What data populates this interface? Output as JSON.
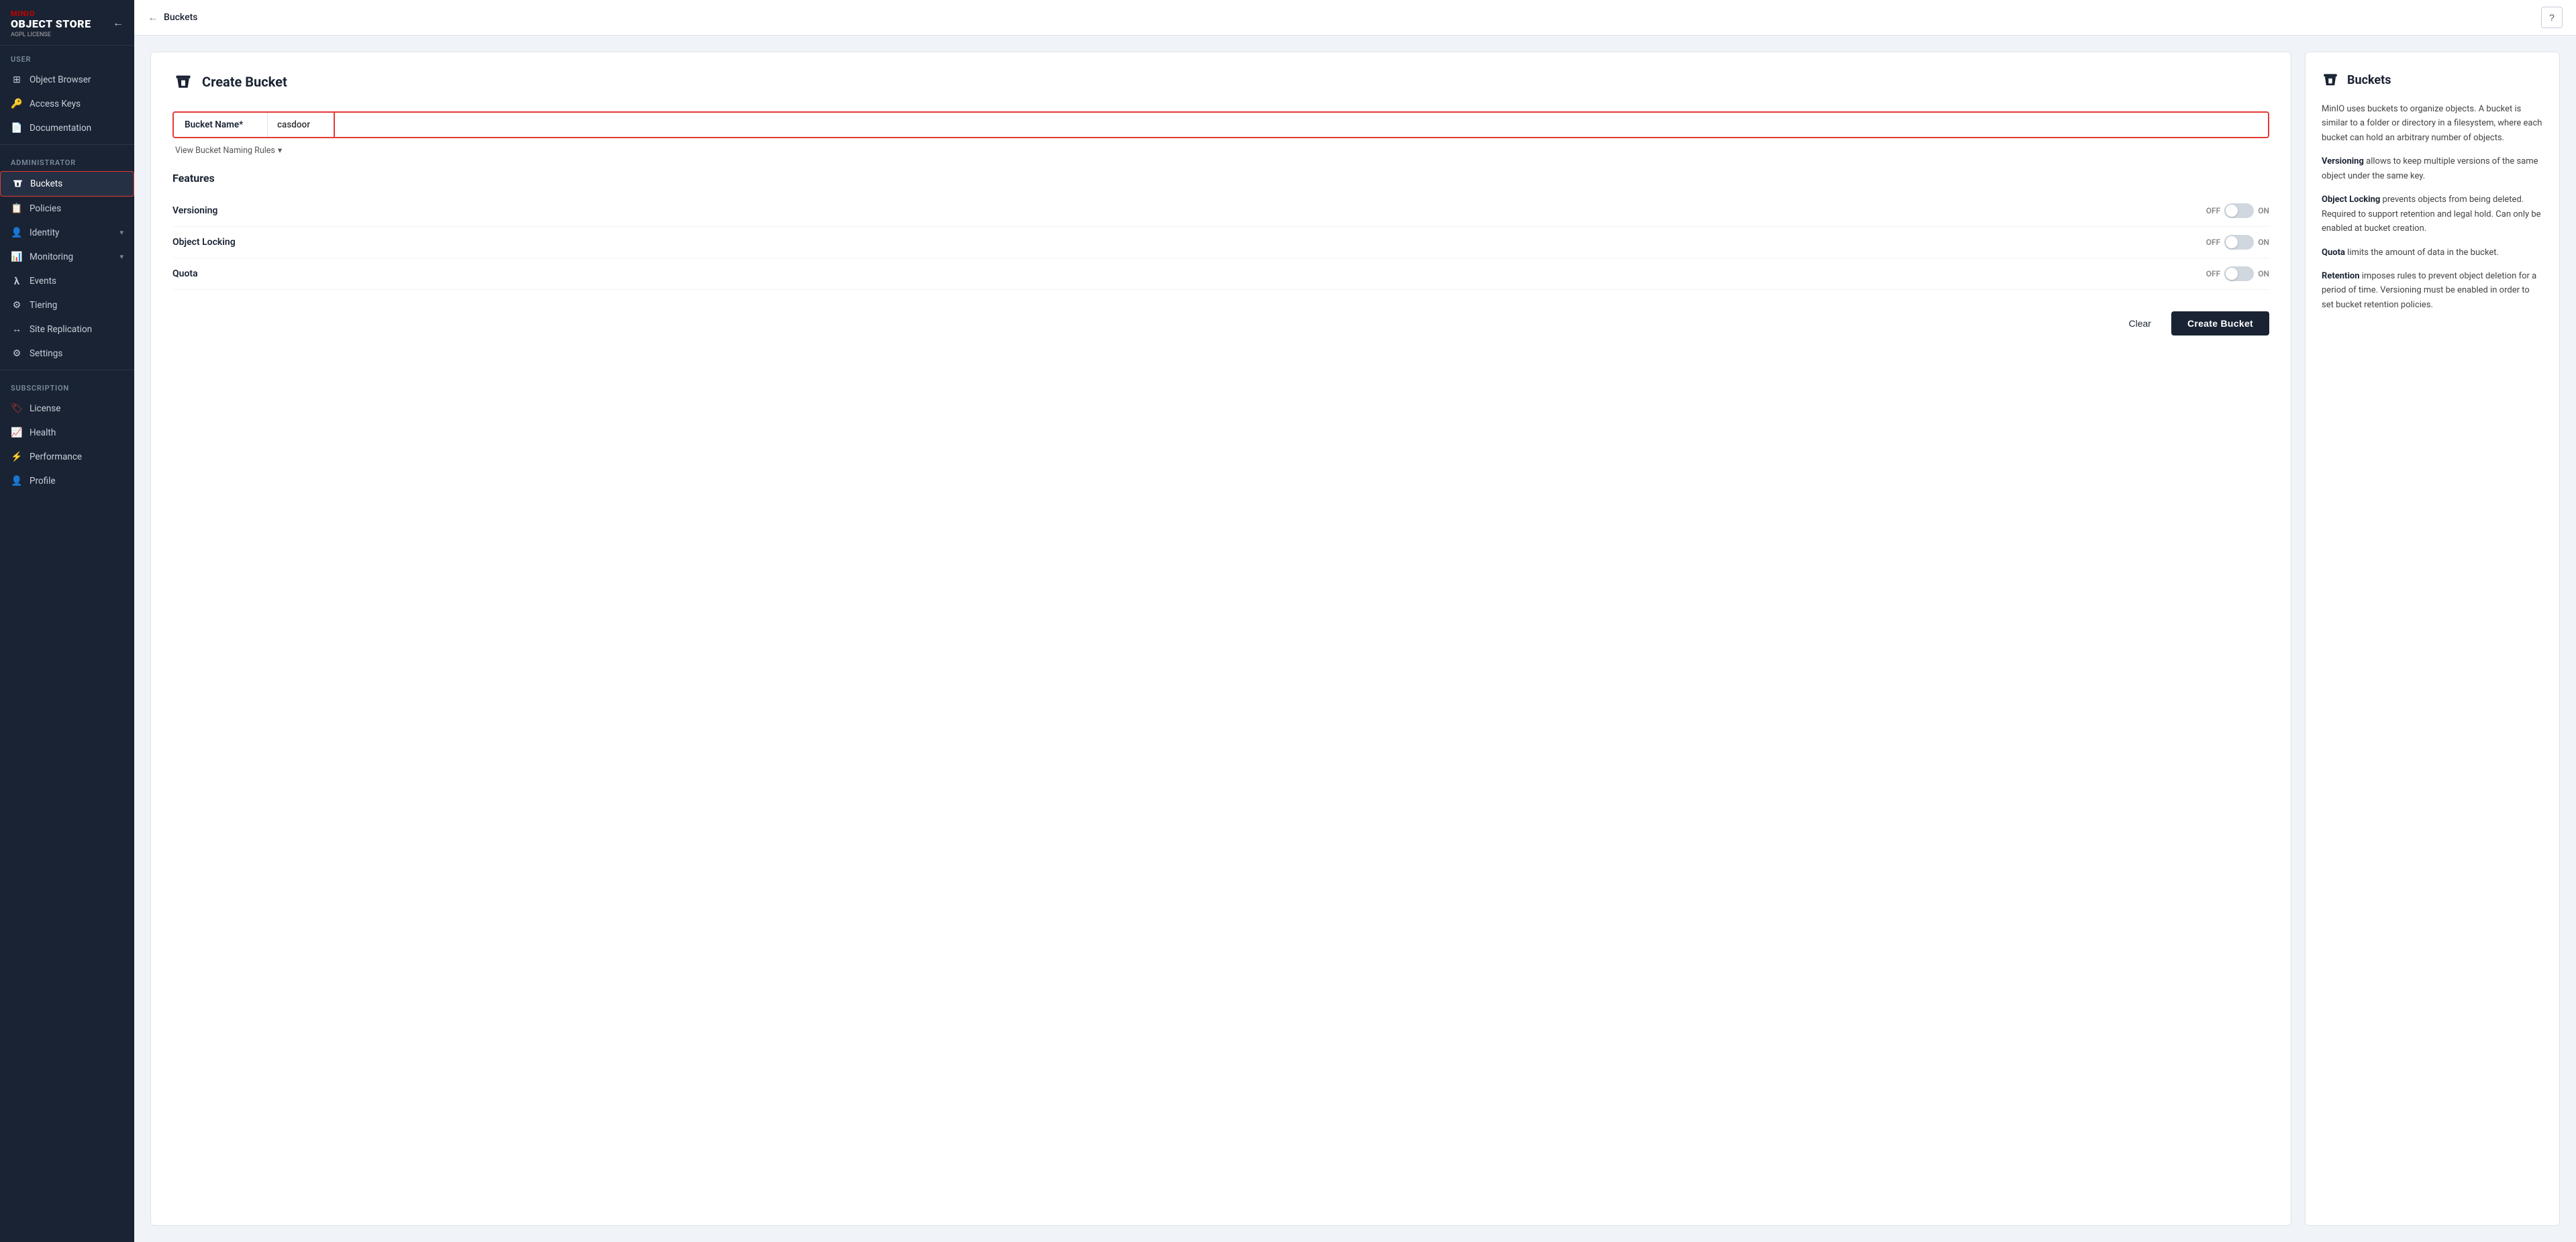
{
  "app": {
    "logo_minio": "MINIO",
    "logo_object_store": "OBJECT STORE",
    "logo_agpl": "AGPL LICENSE"
  },
  "sidebar": {
    "user_section": "User",
    "admin_section": "Administrator",
    "subscription_section": "Subscription",
    "items": [
      {
        "id": "object-browser",
        "label": "Object Browser",
        "icon": "⊞",
        "section": "user"
      },
      {
        "id": "access-keys",
        "label": "Access Keys",
        "icon": "🔑",
        "section": "user"
      },
      {
        "id": "documentation",
        "label": "Documentation",
        "icon": "📄",
        "section": "user"
      },
      {
        "id": "buckets",
        "label": "Buckets",
        "icon": "🪣",
        "section": "admin",
        "active": true
      },
      {
        "id": "policies",
        "label": "Policies",
        "icon": "📋",
        "section": "admin"
      },
      {
        "id": "identity",
        "label": "Identity",
        "icon": "👤",
        "section": "admin",
        "hasChevron": true
      },
      {
        "id": "monitoring",
        "label": "Monitoring",
        "icon": "📊",
        "section": "admin",
        "hasChevron": true
      },
      {
        "id": "events",
        "label": "Events",
        "icon": "λ",
        "section": "admin"
      },
      {
        "id": "tiering",
        "label": "Tiering",
        "icon": "⚙",
        "section": "admin"
      },
      {
        "id": "site-replication",
        "label": "Site Replication",
        "icon": "↔",
        "section": "admin"
      },
      {
        "id": "settings",
        "label": "Settings",
        "icon": "⚙",
        "section": "admin"
      },
      {
        "id": "license",
        "label": "License",
        "icon": "🏷",
        "section": "subscription"
      },
      {
        "id": "health",
        "label": "Health",
        "icon": "📈",
        "section": "subscription"
      },
      {
        "id": "performance",
        "label": "Performance",
        "icon": "⚡",
        "section": "subscription"
      },
      {
        "id": "profile",
        "label": "Profile",
        "icon": "👤",
        "section": "subscription"
      }
    ]
  },
  "topbar": {
    "breadcrumb_back": "←",
    "breadcrumb_label": "Buckets",
    "help_icon": "?"
  },
  "form": {
    "card_title": "Create Bucket",
    "bucket_name_label": "Bucket Name*",
    "bucket_name_value": "casdoor",
    "bucket_name_placeholder": "",
    "naming_rules_link": "View Bucket Naming Rules",
    "features_title": "Features",
    "features": [
      {
        "id": "versioning",
        "label": "Versioning",
        "state": "off"
      },
      {
        "id": "object-locking",
        "label": "Object Locking",
        "state": "off"
      },
      {
        "id": "quota",
        "label": "Quota",
        "state": "off"
      }
    ],
    "toggle_off": "OFF",
    "toggle_on": "ON",
    "clear_btn": "Clear",
    "create_btn": "Create Bucket"
  },
  "info": {
    "title": "Buckets",
    "paragraph1": "MinIO uses buckets to organize objects. A bucket is similar to a folder or directory in a filesystem, where each bucket can hold an arbitrary number of objects.",
    "versioning_bold": "Versioning",
    "versioning_text": " allows to keep multiple versions of the same object under the same key.",
    "object_locking_bold": "Object Locking",
    "object_locking_text": " prevents objects from being deleted. Required to support retention and legal hold. Can only be enabled at bucket creation.",
    "quota_bold": "Quota",
    "quota_text": " limits the amount of data in the bucket.",
    "retention_bold": "Retention",
    "retention_text": " imposes rules to prevent object deletion for a period of time. Versioning must be enabled in order to set bucket retention policies."
  }
}
